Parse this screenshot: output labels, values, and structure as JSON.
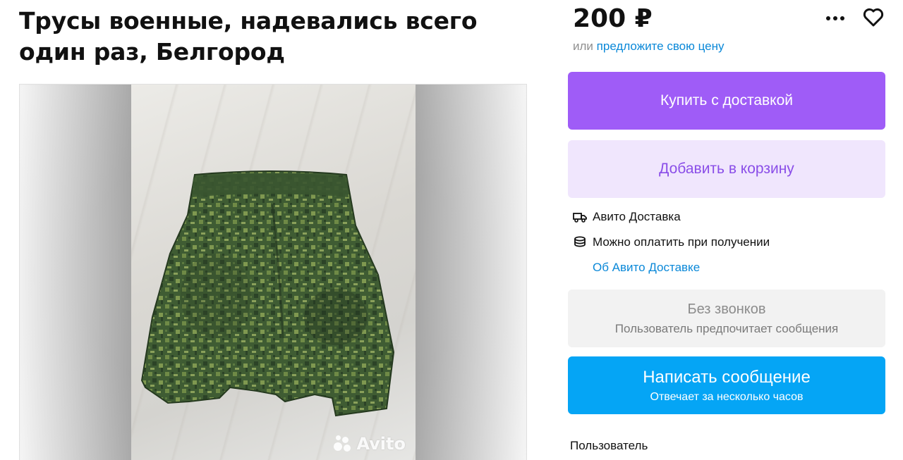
{
  "listing": {
    "title": "Трусы военные, надевались всего один раз, Белгород",
    "price": "200 ₽",
    "offer_prefix": "или",
    "offer_link": "предложите свою цену"
  },
  "gallery": {
    "watermark": "Avito"
  },
  "actions": {
    "buy_label": "Купить с доставкой",
    "cart_label": "Добавить в корзину",
    "no_calls_title": "Без звонков",
    "no_calls_subtitle": "Пользователь предпочитает сообщения",
    "message_title": "Написать сообщение",
    "message_subtitle": "Отвечает за несколько часов"
  },
  "delivery": {
    "avito_delivery": "Авито Доставка",
    "pay_on_receipt": "Можно оплатить при получении",
    "about_link": "Об Авито Доставке"
  },
  "seller": {
    "label": "Пользователь"
  },
  "icons": {
    "more": "more-dots-icon",
    "favorite": "heart-icon",
    "delivery": "truck-icon",
    "payment": "coins-icon"
  },
  "colors": {
    "buy_button": "#9f5cf7",
    "cart_button_bg": "#f0e6fd",
    "cart_button_text": "#8a4ee8",
    "message_button": "#05a5f5",
    "no_calls_bg": "#f2f2f2",
    "link": "#0a88d8",
    "camo_dark": "#2f4a2b",
    "camo_mid": "#4f6e3a",
    "camo_light": "#8aa05a"
  }
}
